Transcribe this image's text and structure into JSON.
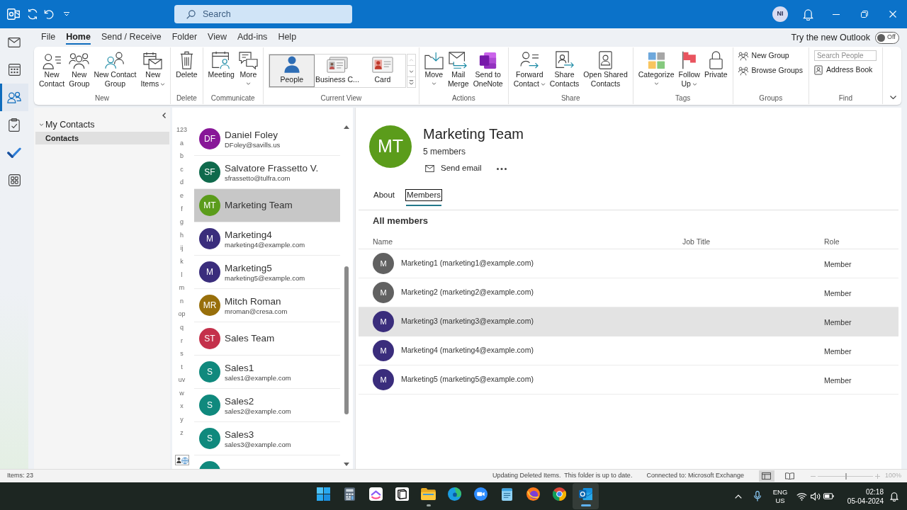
{
  "title_bar": {
    "search": {
      "placeholder": "Search"
    },
    "account": {
      "initials": "NI"
    }
  },
  "nav_rail": [
    {
      "kind": "mail",
      "selected": false
    },
    {
      "kind": "calendar",
      "selected": false
    },
    {
      "kind": "people",
      "selected": true
    },
    {
      "kind": "tasks",
      "selected": false
    },
    {
      "kind": "todo",
      "selected": false
    },
    {
      "kind": "apps",
      "selected": false
    }
  ],
  "menu_tabs": [
    {
      "label": "File",
      "selected": false
    },
    {
      "label": "Home",
      "selected": true
    },
    {
      "label": "Send / Receive",
      "selected": false
    },
    {
      "label": "Folder",
      "selected": false
    },
    {
      "label": "View",
      "selected": false
    },
    {
      "label": "Add-ins",
      "selected": false
    },
    {
      "label": "Help",
      "selected": false
    }
  ],
  "new_outlook": {
    "label": "Try the new Outlook",
    "on": false,
    "switch_label": "Off"
  },
  "ribbon": [
    {
      "label": "New",
      "kind": "buttons",
      "buttons": [
        {
          "label": "New\nContact",
          "kind": "contact",
          "dropdown": false
        },
        {
          "label": "New\nGroup",
          "kind": "group",
          "dropdown": false
        },
        {
          "label": "New Contact\nGroup",
          "kind": "contactgroup",
          "dropdown": false
        },
        {
          "label": "New\nItems",
          "kind": "items",
          "dropdown": true
        }
      ]
    },
    {
      "label": "Delete",
      "kind": "buttons",
      "buttons": [
        {
          "label": "Delete",
          "kind": "delete",
          "dropdown": false
        }
      ]
    },
    {
      "label": "Communicate",
      "kind": "buttons",
      "buttons": [
        {
          "label": "Meeting",
          "kind": "meeting",
          "dropdown": false
        },
        {
          "label": "More",
          "kind": "more",
          "dropdown": true
        }
      ]
    },
    {
      "label": "Current View",
      "kind": "gallery",
      "views": [
        {
          "label": "People",
          "kind": "people",
          "selected": true
        },
        {
          "label": "Business C...",
          "kind": "businesscard",
          "selected": false
        },
        {
          "label": "Card",
          "kind": "card",
          "selected": false
        }
      ]
    },
    {
      "label": "Actions",
      "kind": "buttons",
      "buttons": [
        {
          "label": "Move",
          "kind": "move",
          "dropdown": true
        },
        {
          "label": "Mail\nMerge",
          "kind": "mailmerge",
          "dropdown": false
        },
        {
          "label": "Send to\nOneNote",
          "kind": "onenote",
          "dropdown": false
        }
      ]
    },
    {
      "label": "Share",
      "kind": "buttons",
      "buttons": [
        {
          "label": "Forward\nContact",
          "kind": "forward",
          "dropdown": true
        },
        {
          "label": "Share\nContacts",
          "kind": "share",
          "dropdown": false
        },
        {
          "label": "Open Shared\nContacts",
          "kind": "openshared",
          "dropdown": false
        }
      ]
    },
    {
      "label": "Tags",
      "kind": "buttons",
      "buttons": [
        {
          "label": "Categorize",
          "kind": "categorize",
          "dropdown": true
        },
        {
          "label": "Follow\nUp",
          "kind": "flag",
          "dropdown": true
        },
        {
          "label": "Private",
          "kind": "lock",
          "dropdown": false
        }
      ]
    },
    {
      "label": "Groups",
      "kind": "links",
      "links": [
        {
          "label": "New Group",
          "kind": "group"
        },
        {
          "label": "Browse Groups",
          "kind": "group"
        }
      ]
    },
    {
      "label": "Find",
      "kind": "find",
      "search": {
        "placeholder": "Search People"
      },
      "links": [
        {
          "label": "Address Book",
          "kind": "addressbook"
        }
      ]
    }
  ],
  "folders": [
    {
      "label": "My Contacts",
      "expanded": true,
      "selected": false,
      "children": [
        {
          "label": "Contacts",
          "selected": true
        }
      ]
    }
  ],
  "contact_list": {
    "index": [
      "123",
      "a",
      "b",
      "c",
      "d",
      "e",
      "f",
      "g",
      "h",
      "ij",
      "k",
      "l",
      "m",
      "n",
      "op",
      "q",
      "r",
      "s",
      "t",
      "uv",
      "w",
      "x",
      "y",
      "z"
    ],
    "contacts": [
      {
        "name": "Daniel Foley",
        "email": "DFoley@savills.us",
        "initials": "DF",
        "color": "#881798",
        "selected": false
      },
      {
        "name": "Salvatore Frassetto V.",
        "email": "sfrassetto@tulfra.com",
        "initials": "SF",
        "color": "#0f6a4c",
        "selected": false
      },
      {
        "name": "Marketing Team",
        "initials": "MT",
        "color": "#5b9c1b",
        "selected": true
      },
      {
        "name": "Marketing4",
        "email": "marketing4@example.com",
        "initials": "M",
        "color": "#3a2d7c",
        "selected": false
      },
      {
        "name": "Marketing5",
        "email": "marketing5@example.com",
        "initials": "M",
        "color": "#3a2d7c",
        "selected": false
      },
      {
        "name": "Mitch Roman",
        "email": "mroman@cresa.com",
        "initials": "MR",
        "color": "#986f0b",
        "selected": false
      },
      {
        "name": "Sales Team",
        "initials": "ST",
        "color": "#c4314b",
        "selected": false
      },
      {
        "name": "Sales1",
        "email": "sales1@example.com",
        "initials": "S",
        "color": "#10897d",
        "selected": false
      },
      {
        "name": "Sales2",
        "email": "sales2@example.com",
        "initials": "S",
        "color": "#10897d",
        "selected": false
      },
      {
        "name": "Sales3",
        "email": "sales3@example.com",
        "initials": "S",
        "color": "#10897d",
        "selected": false
      },
      {
        "color": "#10897d",
        "selected": false
      }
    ]
  },
  "contact_card": {
    "initials": "MT",
    "color": "#5b9c1b",
    "name": "Marketing Team",
    "subtitle": "5 members",
    "send_email": "Send email",
    "tabs": [
      {
        "label": "About",
        "selected": false
      },
      {
        "label": "Members",
        "selected": true
      }
    ],
    "members": {
      "title": "All members",
      "columns": [
        "Name",
        "Job Title",
        "Role"
      ],
      "rows": [
        {
          "initials": "M",
          "color": "#616161",
          "name": "Marketing1 (marketing1@example.com)",
          "role": "Member",
          "highlighted": false
        },
        {
          "initials": "M",
          "color": "#616161",
          "name": "Marketing2 (marketing2@example.com)",
          "role": "Member",
          "highlighted": false
        },
        {
          "initials": "M",
          "color": "#3a2d7c",
          "name": "Marketing3 (marketing3@example.com)",
          "role": "Member",
          "highlighted": true
        },
        {
          "initials": "M",
          "color": "#3a2d7c",
          "name": "Marketing4 (marketing4@example.com)",
          "role": "Member",
          "highlighted": false
        },
        {
          "initials": "M",
          "color": "#3a2d7c",
          "name": "Marketing5 (marketing5@example.com)",
          "role": "Member",
          "highlighted": false
        }
      ]
    }
  },
  "status_bar": {
    "items": "Items: 23",
    "sync": "Updating Deleted Items.  This folder is up to date.",
    "connection": "Connected to: Microsoft Exchange",
    "zoom": {
      "level": 0.5,
      "label": "100%"
    }
  },
  "taskbar": {
    "apps": [
      {
        "kind": "start",
        "running": false,
        "selected": false
      },
      {
        "kind": "calculator",
        "running": false,
        "selected": false
      },
      {
        "kind": "chevron",
        "running": false,
        "selected": false
      },
      {
        "kind": "cube",
        "running": false,
        "selected": false
      },
      {
        "kind": "folder",
        "running": true,
        "selected": false
      },
      {
        "kind": "swirl",
        "running": false,
        "selected": false
      },
      {
        "kind": "camera",
        "running": false,
        "selected": false
      },
      {
        "kind": "notepad",
        "running": false,
        "selected": false
      },
      {
        "kind": "flame",
        "running": false,
        "selected": false
      },
      {
        "kind": "ring",
        "running": false,
        "selected": false
      },
      {
        "kind": "mail",
        "running": true,
        "selected": true
      }
    ],
    "tray": {
      "language": "ENG",
      "region": "US",
      "time": "02:18",
      "date": "05-04-2024"
    }
  }
}
